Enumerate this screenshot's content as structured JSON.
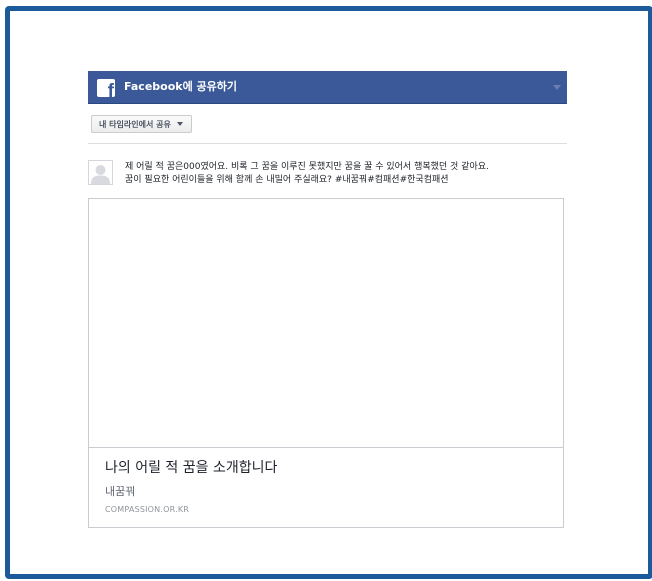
{
  "header": {
    "logo_letter": "f",
    "title": "Facebook에 공유하기",
    "menu_icon": "chevron-down-icon"
  },
  "audience": {
    "label": "내 타임라인에서 공유",
    "icon": "caret-down-icon"
  },
  "composer": {
    "avatar_icon": "default-profile-icon",
    "message_lines": [
      "제 어릴 적 꿈은000였어요. 비록 그 꿈을 이루진 못했지만 꿈을 꿀 수 있어서 행복했던 것 같아요.",
      "꿈이 필요한 어린이들을 위해 함께 손 내밀어 주실래요? #내꿈꿔#컴패션#한국컴패션"
    ]
  },
  "link_preview": {
    "title": "나의 어릴 적 꿈을 소개합니다",
    "description": "내꿈꿔",
    "domain": "COMPASSION.OR.KR"
  },
  "colors": {
    "frame_border": "#1d5a9c",
    "facebook_blue": "#3b5998",
    "divider": "#dddddd"
  }
}
